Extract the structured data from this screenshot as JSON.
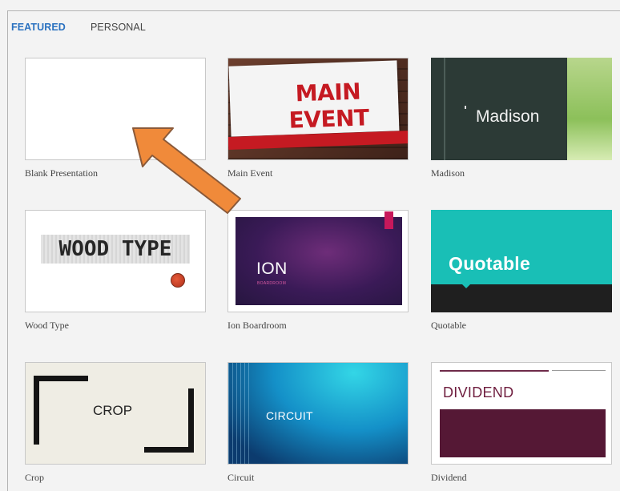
{
  "tabs": {
    "featured": "FEATURED",
    "personal": "PERSONAL"
  },
  "templates": [
    {
      "label": "Blank Presentation"
    },
    {
      "label": "Main Event",
      "thumb_text": "MAIN EVENT"
    },
    {
      "label": "Madison",
      "thumb_text": "Madison"
    },
    {
      "label": "Wood Type",
      "thumb_text": "WOOD TYPE"
    },
    {
      "label": "Ion Boardroom",
      "thumb_text": "ION",
      "thumb_subtext": "BOARDROOM"
    },
    {
      "label": "Quotable",
      "thumb_text": "Quotable"
    },
    {
      "label": "Crop",
      "thumb_text": "CROP"
    },
    {
      "label": "Circuit",
      "thumb_text": "CIRCUIT"
    },
    {
      "label": "Dividend",
      "thumb_text": "DIVIDEND"
    }
  ],
  "annotation": {
    "icon": "arrow-pointer-icon",
    "color": "#f08a3a"
  }
}
